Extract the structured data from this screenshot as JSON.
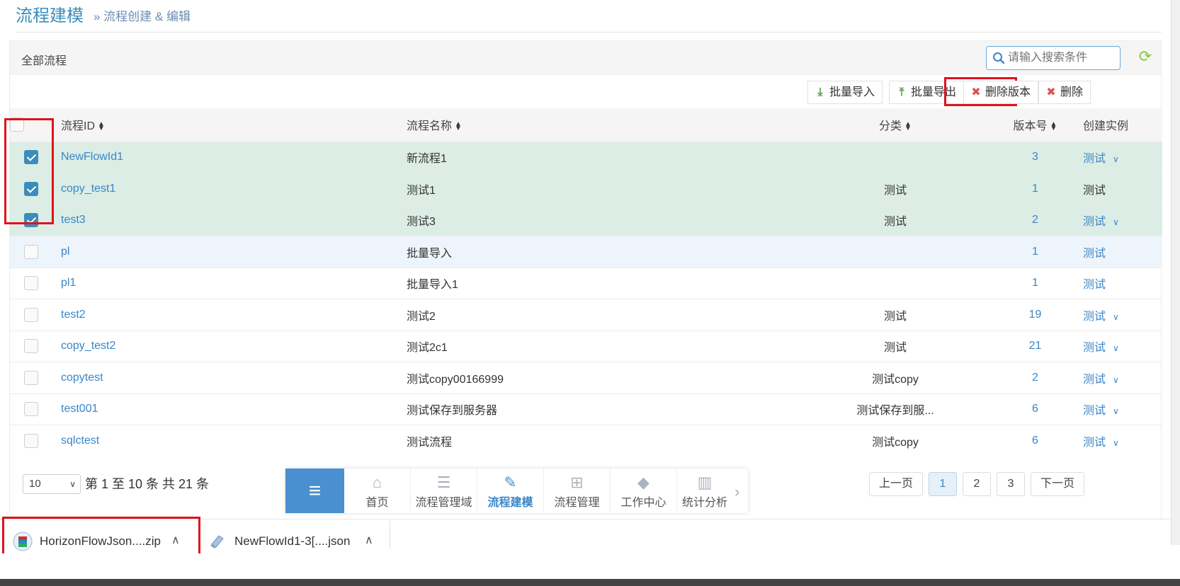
{
  "header": {
    "title": "流程建模",
    "breadcrumb": "» 流程创建 & 编辑"
  },
  "panel": {
    "title": "全部流程",
    "search_placeholder": "请输入搜索条件",
    "toolbar": {
      "import_label": "批量导入",
      "export_label": "批量导出",
      "delete_version_label": "删除版本",
      "delete_label": "删除"
    }
  },
  "table": {
    "columns": [
      "流程ID",
      "流程名称",
      "分类",
      "版本号",
      "创建实例"
    ],
    "rows": [
      {
        "id": "NewFlowId1",
        "name": "新流程1",
        "category": "",
        "version": "3",
        "instance": "测试",
        "checked": true,
        "has_menu": true
      },
      {
        "id": "copy_test1",
        "name": "测试1",
        "category": "测试",
        "version": "1",
        "instance": "测试",
        "checked": true,
        "has_menu": false
      },
      {
        "id": "test3",
        "name": "测试3",
        "category": "测试",
        "version": "2",
        "instance": "测试",
        "checked": true,
        "has_menu": true
      },
      {
        "id": "pl",
        "name": "批量导入",
        "category": "",
        "version": "1",
        "instance": "测试",
        "checked": false,
        "has_menu": false
      },
      {
        "id": "pl1",
        "name": "批量导入1",
        "category": "",
        "version": "1",
        "instance": "测试",
        "checked": false,
        "has_menu": false
      },
      {
        "id": "test2",
        "name": "测试2",
        "category": "测试",
        "version": "19",
        "instance": "测试",
        "checked": false,
        "has_menu": true
      },
      {
        "id": "copy_test2",
        "name": "测试2c1",
        "category": "测试",
        "version": "21",
        "instance": "测试",
        "checked": false,
        "has_menu": true
      },
      {
        "id": "copytest",
        "name": "测试copy00166999",
        "category": "测试copy",
        "version": "2",
        "instance": "测试",
        "checked": false,
        "has_menu": true
      },
      {
        "id": "test001",
        "name": "测试保存到服务器",
        "category": "测试保存到服...",
        "version": "6",
        "instance": "测试",
        "checked": false,
        "has_menu": true
      },
      {
        "id": "sqlctest",
        "name": "测试流程",
        "category": "测试copy",
        "version": "6",
        "instance": "测试",
        "checked": false,
        "has_menu": true
      }
    ]
  },
  "pagination": {
    "page_size": "10",
    "info": "第 1 至 10 条 共 21 条",
    "prev": "上一页",
    "pages": [
      "1",
      "2",
      "3"
    ],
    "current_page": "1",
    "next": "下一页"
  },
  "dock": {
    "items": [
      {
        "label": "首页",
        "icon": "home-icon"
      },
      {
        "label": "流程管理域",
        "icon": "list-icon"
      },
      {
        "label": "流程建模",
        "icon": "edit-icon"
      },
      {
        "label": "流程管理",
        "icon": "sitemap-icon"
      },
      {
        "label": "工作中心",
        "icon": "tag-icon"
      },
      {
        "label": "统计分析",
        "icon": "bar-chart-icon"
      }
    ],
    "active": "流程建模"
  },
  "downloads": [
    {
      "name": "HorizonFlowJson....zip",
      "icon": "archive-icon"
    },
    {
      "name": "NewFlowId1-3[....json",
      "icon": "json-file-icon"
    }
  ],
  "colors": {
    "accent": "#3c8dbc",
    "selected_row": "#dcede5",
    "highlight_box": "#e0121c",
    "refresh": "#8cc63f"
  }
}
